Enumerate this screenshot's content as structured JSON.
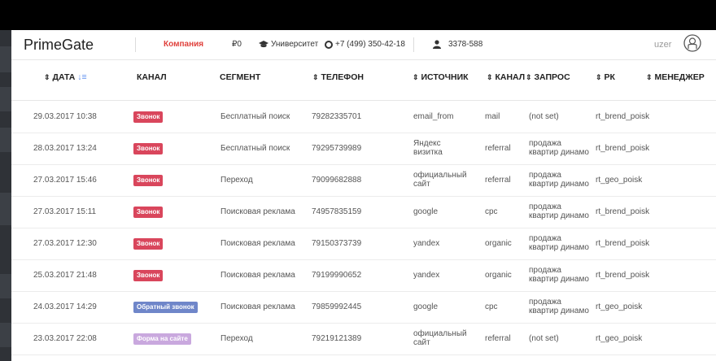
{
  "header": {
    "brand": "PrimeGate",
    "company": "Компания",
    "balance": "₽0",
    "university": "Университет",
    "phone": "+7 (499) 350-42-18",
    "account": "3378-588",
    "user": "uzer"
  },
  "columns": {
    "date": "ДАТА",
    "channel": "КАНАЛ",
    "segment": "СЕГМЕНТ",
    "phone": "ТЕЛЕФОН",
    "source": "ИСТОЧНИК",
    "channel2": "КАНАЛ",
    "query": "ЗАПРОС",
    "rk": "РК",
    "manager": "МЕНЕДЖЕР"
  },
  "colors": {
    "call": "#d9465c",
    "callback": "#6f86c9",
    "form": "#c9a8de"
  },
  "rows": [
    {
      "date": "29.03.2017 10:38",
      "channel": "Звонок",
      "channel_type": "call",
      "segment": "Бесплатный поиск",
      "phone": "79282335701",
      "source": "email_from",
      "source2": "",
      "medium": "mail",
      "query": "(not set)",
      "query2": "",
      "rk": "rt_brend_poisk"
    },
    {
      "date": "28.03.2017 13:24",
      "channel": "Звонок",
      "channel_type": "call",
      "segment": "Бесплатный поиск",
      "phone": "79295739989",
      "source": "Яндекс",
      "source2": "визитка",
      "medium": "referral",
      "query": "продажа",
      "query2": "квартир динамо",
      "rk": "rt_brend_poisk"
    },
    {
      "date": "27.03.2017 15:46",
      "channel": "Звонок",
      "channel_type": "call",
      "segment": "Переход",
      "phone": "79099682888",
      "source": "официальный",
      "source2": "сайт",
      "medium": "referral",
      "query": "продажа",
      "query2": "квартир динамо",
      "rk": "rt_geo_poisk"
    },
    {
      "date": "27.03.2017 15:11",
      "channel": "Звонок",
      "channel_type": "call",
      "segment": "Поисковая реклама",
      "phone": "74957835159",
      "source": "google",
      "source2": "",
      "medium": "cpc",
      "query": "продажа",
      "query2": "квартир динамо",
      "rk": "rt_brend_poisk"
    },
    {
      "date": "27.03.2017 12:30",
      "channel": "Звонок",
      "channel_type": "call",
      "segment": "Поисковая реклама",
      "phone": "79150373739",
      "source": "yandex",
      "source2": "",
      "medium": "organic",
      "query": "продажа",
      "query2": "квартир динамо",
      "rk": "rt_brend_poisk"
    },
    {
      "date": "25.03.2017 21:48",
      "channel": "Звонок",
      "channel_type": "call",
      "segment": "Поисковая реклама",
      "phone": "79199990652",
      "source": "yandex",
      "source2": "",
      "medium": "organic",
      "query": "продажа",
      "query2": "квартир динамо",
      "rk": "rt_brend_poisk"
    },
    {
      "date": "24.03.2017 14:29",
      "channel": "Обратный звонок",
      "channel_type": "callback",
      "segment": "Поисковая реклама",
      "phone": "79859992445",
      "source": "google",
      "source2": "",
      "medium": "cpc",
      "query": "продажа",
      "query2": "квартир динамо",
      "rk": "rt_geo_poisk"
    },
    {
      "date": "23.03.2017 22:08",
      "channel": "Форма на сайте",
      "channel_type": "form",
      "segment": "Переход",
      "phone": "79219121389",
      "source": "официальный",
      "source2": "сайт",
      "medium": "referral",
      "query": "(not set)",
      "query2": "",
      "rk": "rt_geo_poisk"
    }
  ]
}
